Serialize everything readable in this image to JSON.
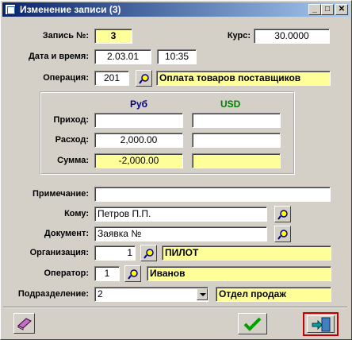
{
  "window": {
    "title": "Изменение записи (3)",
    "min": "_",
    "max": "□",
    "close": "✕"
  },
  "record": {
    "label": "Запись №:",
    "value": "3"
  },
  "rate": {
    "label": "Курс:",
    "value": "30.0000"
  },
  "datetime": {
    "label": "Дата и время:",
    "date": "2.03.01",
    "time": "10:35"
  },
  "operation": {
    "label": "Операция:",
    "code": "201",
    "name": "Оплата товаров поставщиков"
  },
  "currency_group": {
    "col_rub": "Руб",
    "col_usd": "USD",
    "col_rub_color": "#000080",
    "col_usd_color": "#008000",
    "rows": [
      {
        "label": "Приход:",
        "rub": "",
        "usd": ""
      },
      {
        "label": "Расход:",
        "rub": "2,000.00",
        "usd": ""
      },
      {
        "label": "Сумма:",
        "rub": "-2,000.00",
        "usd": ""
      }
    ]
  },
  "note": {
    "label": "Примечание:",
    "value": ""
  },
  "recipient": {
    "label": "Кому:",
    "value": "Петров П.П."
  },
  "document": {
    "label": "Документ:",
    "value": "Заявка №"
  },
  "organization": {
    "label": "Организация:",
    "code": "1",
    "name": "ПИЛОТ"
  },
  "operator": {
    "label": "Оператор:",
    "code": "1",
    "name": "Иванов"
  },
  "department": {
    "label": "Подразделение:",
    "code": "2",
    "name": "Отдел продаж"
  },
  "icons": {
    "picker": "magnifier-pick-icon",
    "help": "book-icon",
    "ok": "checkmark-icon",
    "exit": "exit-door-icon"
  }
}
